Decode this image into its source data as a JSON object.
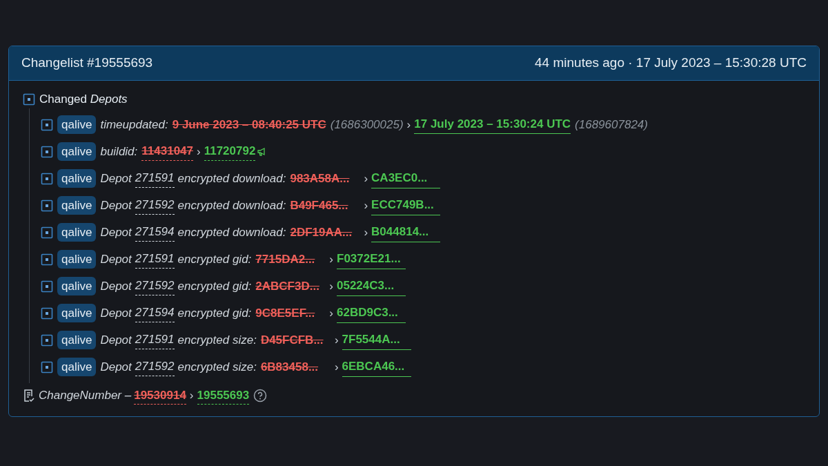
{
  "header": {
    "title": "Changelist #19555693",
    "time": "44 minutes ago · 17 July 2023 – 15:30:28 UTC"
  },
  "group": {
    "label": "Changed",
    "label_em": "Depots",
    "expanded": true
  },
  "items": [
    {
      "kind": "time",
      "tag": "qalive",
      "key": "timeupdated:",
      "old": "9 June 2023 – 08:40:25 UTC",
      "old_note": "(1686300025)",
      "sep": "›",
      "new": "17 July 2023 – 15:30:24 UTC",
      "new_note": "(1689607824)"
    },
    {
      "kind": "plain",
      "tag": "qalive",
      "key": "buildid:",
      "old": "11431047",
      "sep": "›",
      "new": "11720792"
    },
    {
      "kind": "depot",
      "tag": "qalive",
      "prefix": "Depot",
      "depot": "271591",
      "key": "encrypted download:",
      "old": "983A58A...",
      "sep": "›",
      "new": "CA3EC0..."
    },
    {
      "kind": "depot",
      "tag": "qalive",
      "prefix": "Depot",
      "depot": "271592",
      "key": "encrypted download:",
      "old": "B49F465...",
      "sep": "›",
      "new": "ECC749B..."
    },
    {
      "kind": "depot",
      "tag": "qalive",
      "prefix": "Depot",
      "depot": "271594",
      "key": "encrypted download:",
      "old": "2DF19AA...",
      "sep": "›",
      "new": "B044814..."
    },
    {
      "kind": "depot",
      "tag": "qalive",
      "prefix": "Depot",
      "depot": "271591",
      "key": "encrypted gid:",
      "old": "7715DA2...",
      "sep": "›",
      "new": "F0372E21..."
    },
    {
      "kind": "depot",
      "tag": "qalive",
      "prefix": "Depot",
      "depot": "271592",
      "key": "encrypted gid:",
      "old": "2ABCF3D...",
      "sep": "›",
      "new": "05224C3..."
    },
    {
      "kind": "depot",
      "tag": "qalive",
      "prefix": "Depot",
      "depot": "271594",
      "key": "encrypted gid:",
      "old": "9C8E5EF...",
      "sep": "›",
      "new": "62BD9C3..."
    },
    {
      "kind": "depot",
      "tag": "qalive",
      "prefix": "Depot",
      "depot": "271591",
      "key": "encrypted size:",
      "old": "D45FCFB...",
      "sep": "›",
      "new": "7F5544A..."
    },
    {
      "kind": "depot",
      "tag": "qalive",
      "prefix": "Depot",
      "depot": "271592",
      "key": "encrypted size:",
      "old": "6B83458...",
      "sep": "›",
      "new": "6EBCA46..."
    }
  ],
  "change_number": {
    "key": "ChangeNumber –",
    "old": "19530914",
    "sep": "›",
    "new": "19555693"
  }
}
